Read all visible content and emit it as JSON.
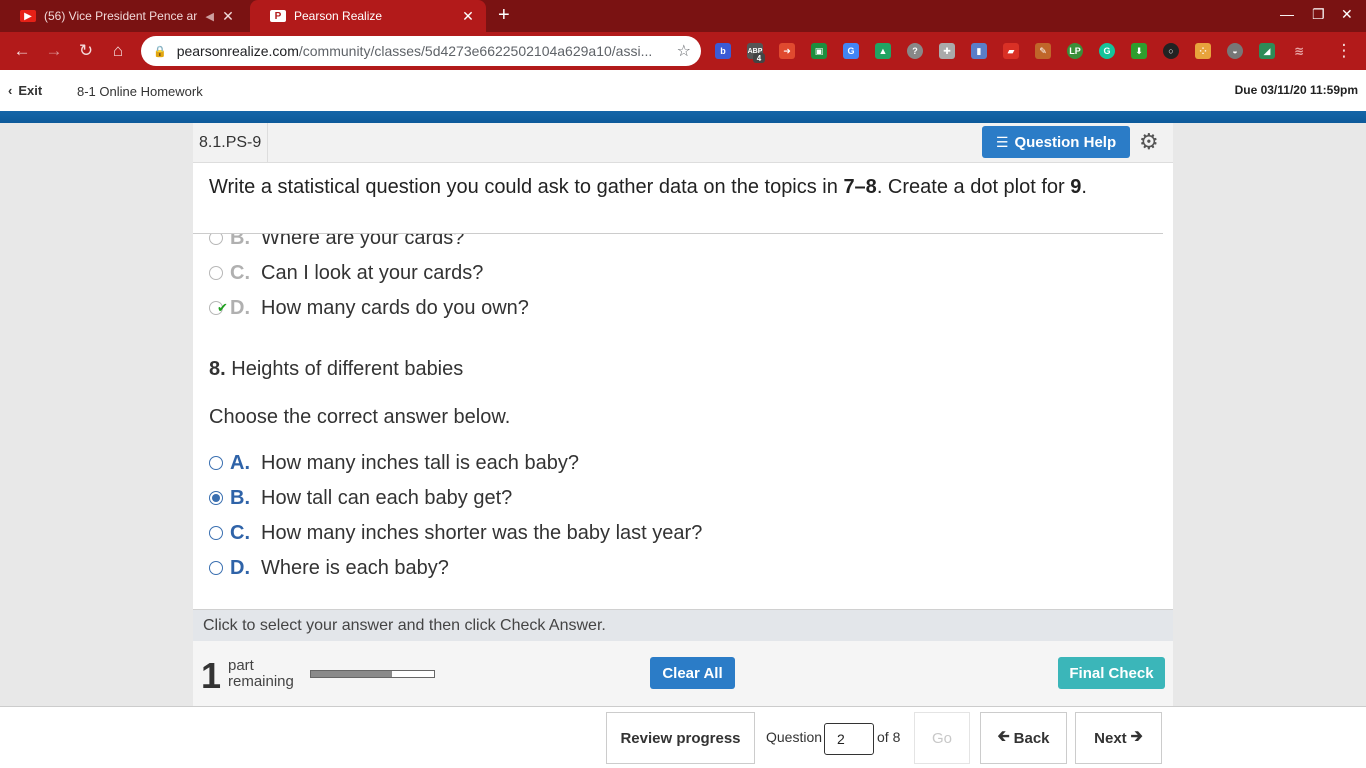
{
  "browser": {
    "tabs": [
      {
        "title": "(56) Vice President Pence ar",
        "favicon": "youtube-icon"
      },
      {
        "title": "Pearson Realize",
        "favicon": "pearson-icon"
      }
    ],
    "url_host": "pearsonrealize.com",
    "url_path": "/community/classes/5d4273e6622502104a629a10/assi...",
    "extension_badge": "4"
  },
  "appbar": {
    "exit_label": "Exit",
    "assignment_title": "8-1 Online Homework",
    "due": "Due 03/11/20 11:59pm"
  },
  "question": {
    "id": "8.1.PS-9",
    "help_label": "Question Help",
    "prompt_pre": "Write a statistical question you could ask to gather data on the topics in ",
    "prompt_range": "7–8",
    "prompt_mid": ". Create a dot plot for ",
    "prompt_num": "9",
    "prompt_end": ".",
    "prev_options": [
      {
        "letter": "B.",
        "text": "Where are your cards?"
      },
      {
        "letter": "C.",
        "text": "Can I look at your cards?"
      },
      {
        "letter": "D.",
        "text": "How many cards do you own?"
      }
    ],
    "part_number": "8.",
    "part_title": "Heights of different babies",
    "choose_text": "Choose the correct answer below.",
    "options": [
      {
        "letter": "A.",
        "text": "How many inches tall is each baby?"
      },
      {
        "letter": "B.",
        "text": "How tall can each baby get?"
      },
      {
        "letter": "C.",
        "text": "How many inches shorter was the baby last year?"
      },
      {
        "letter": "D.",
        "text": "Where is each baby?"
      }
    ],
    "selected_option": "B.",
    "instruction": "Click to select your answer and then click Check Answer."
  },
  "footer": {
    "parts_remaining": "1",
    "parts_label_1": "part",
    "parts_label_2": "remaining",
    "progress_fraction": 0.66,
    "clear_all_label": "Clear All",
    "final_check_label": "Final Check"
  },
  "bottom_nav": {
    "review_label": "Review progress",
    "question_label": "Question",
    "question_value": "2",
    "of_label": "of 8",
    "go_label": "Go",
    "back_label": "Back",
    "next_label": "Next"
  },
  "colors": {
    "browser_frame": "#7a1212",
    "toolbar": "#b21a1a",
    "primary_button": "#2b7cc7",
    "final_check": "#3bb6b9",
    "option_letter": "#2f63a8"
  }
}
